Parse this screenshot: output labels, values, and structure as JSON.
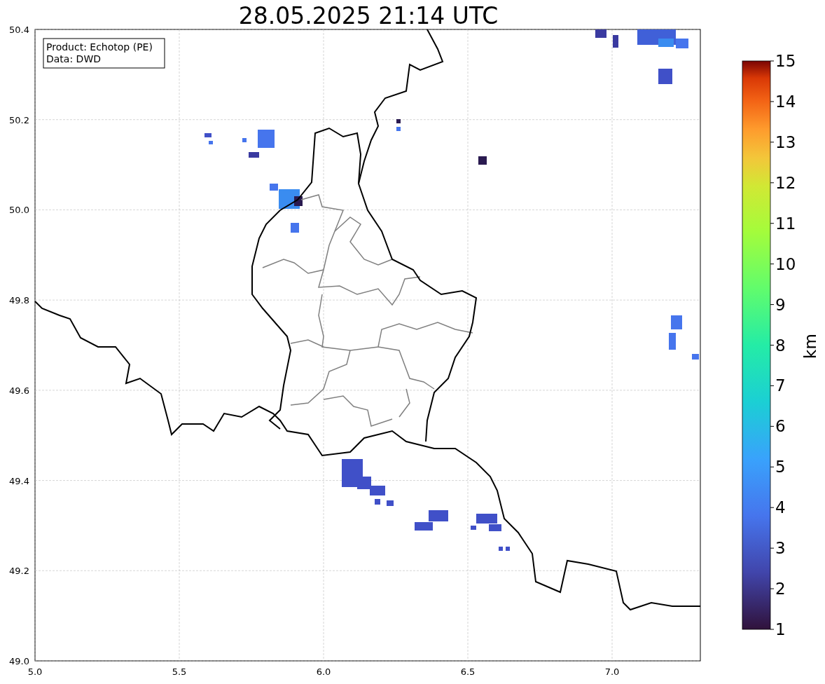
{
  "title": "28.05.2025 21:14 UTC",
  "map": {
    "info_box": [
      "Product: Echotop (PE)",
      "Data: DWD"
    ],
    "x_ticks": [
      "5.0",
      "5.5",
      "6.0",
      "6.5",
      "7.0"
    ],
    "y_ticks": [
      "50.4",
      "50.2",
      "50.0",
      "49.8",
      "49.6",
      "49.4",
      "49.2",
      "49.0"
    ]
  },
  "colorbar": {
    "label": "km",
    "ticks": [
      "15",
      "14",
      "13",
      "12",
      "11",
      "10",
      "9",
      "8",
      "7",
      "6",
      "5",
      "4",
      "3",
      "2",
      "1"
    ]
  }
}
